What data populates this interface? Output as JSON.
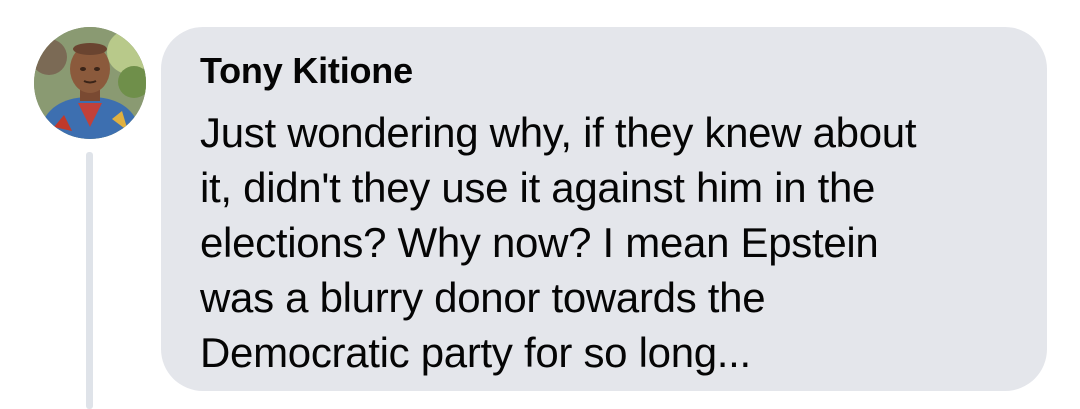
{
  "comment": {
    "author": "Tony Kitione",
    "text": "Just wondering why, if they knew about\nit, didn't they use it against him in the\nelections? Why now? I mean Epstein\nwas a blurry donor towards the\nDemocratic party for so long...",
    "avatar_icon": "profile-photo",
    "bubble_color": "#e4e6eb",
    "thread_line_color": "#dfe3e9"
  }
}
